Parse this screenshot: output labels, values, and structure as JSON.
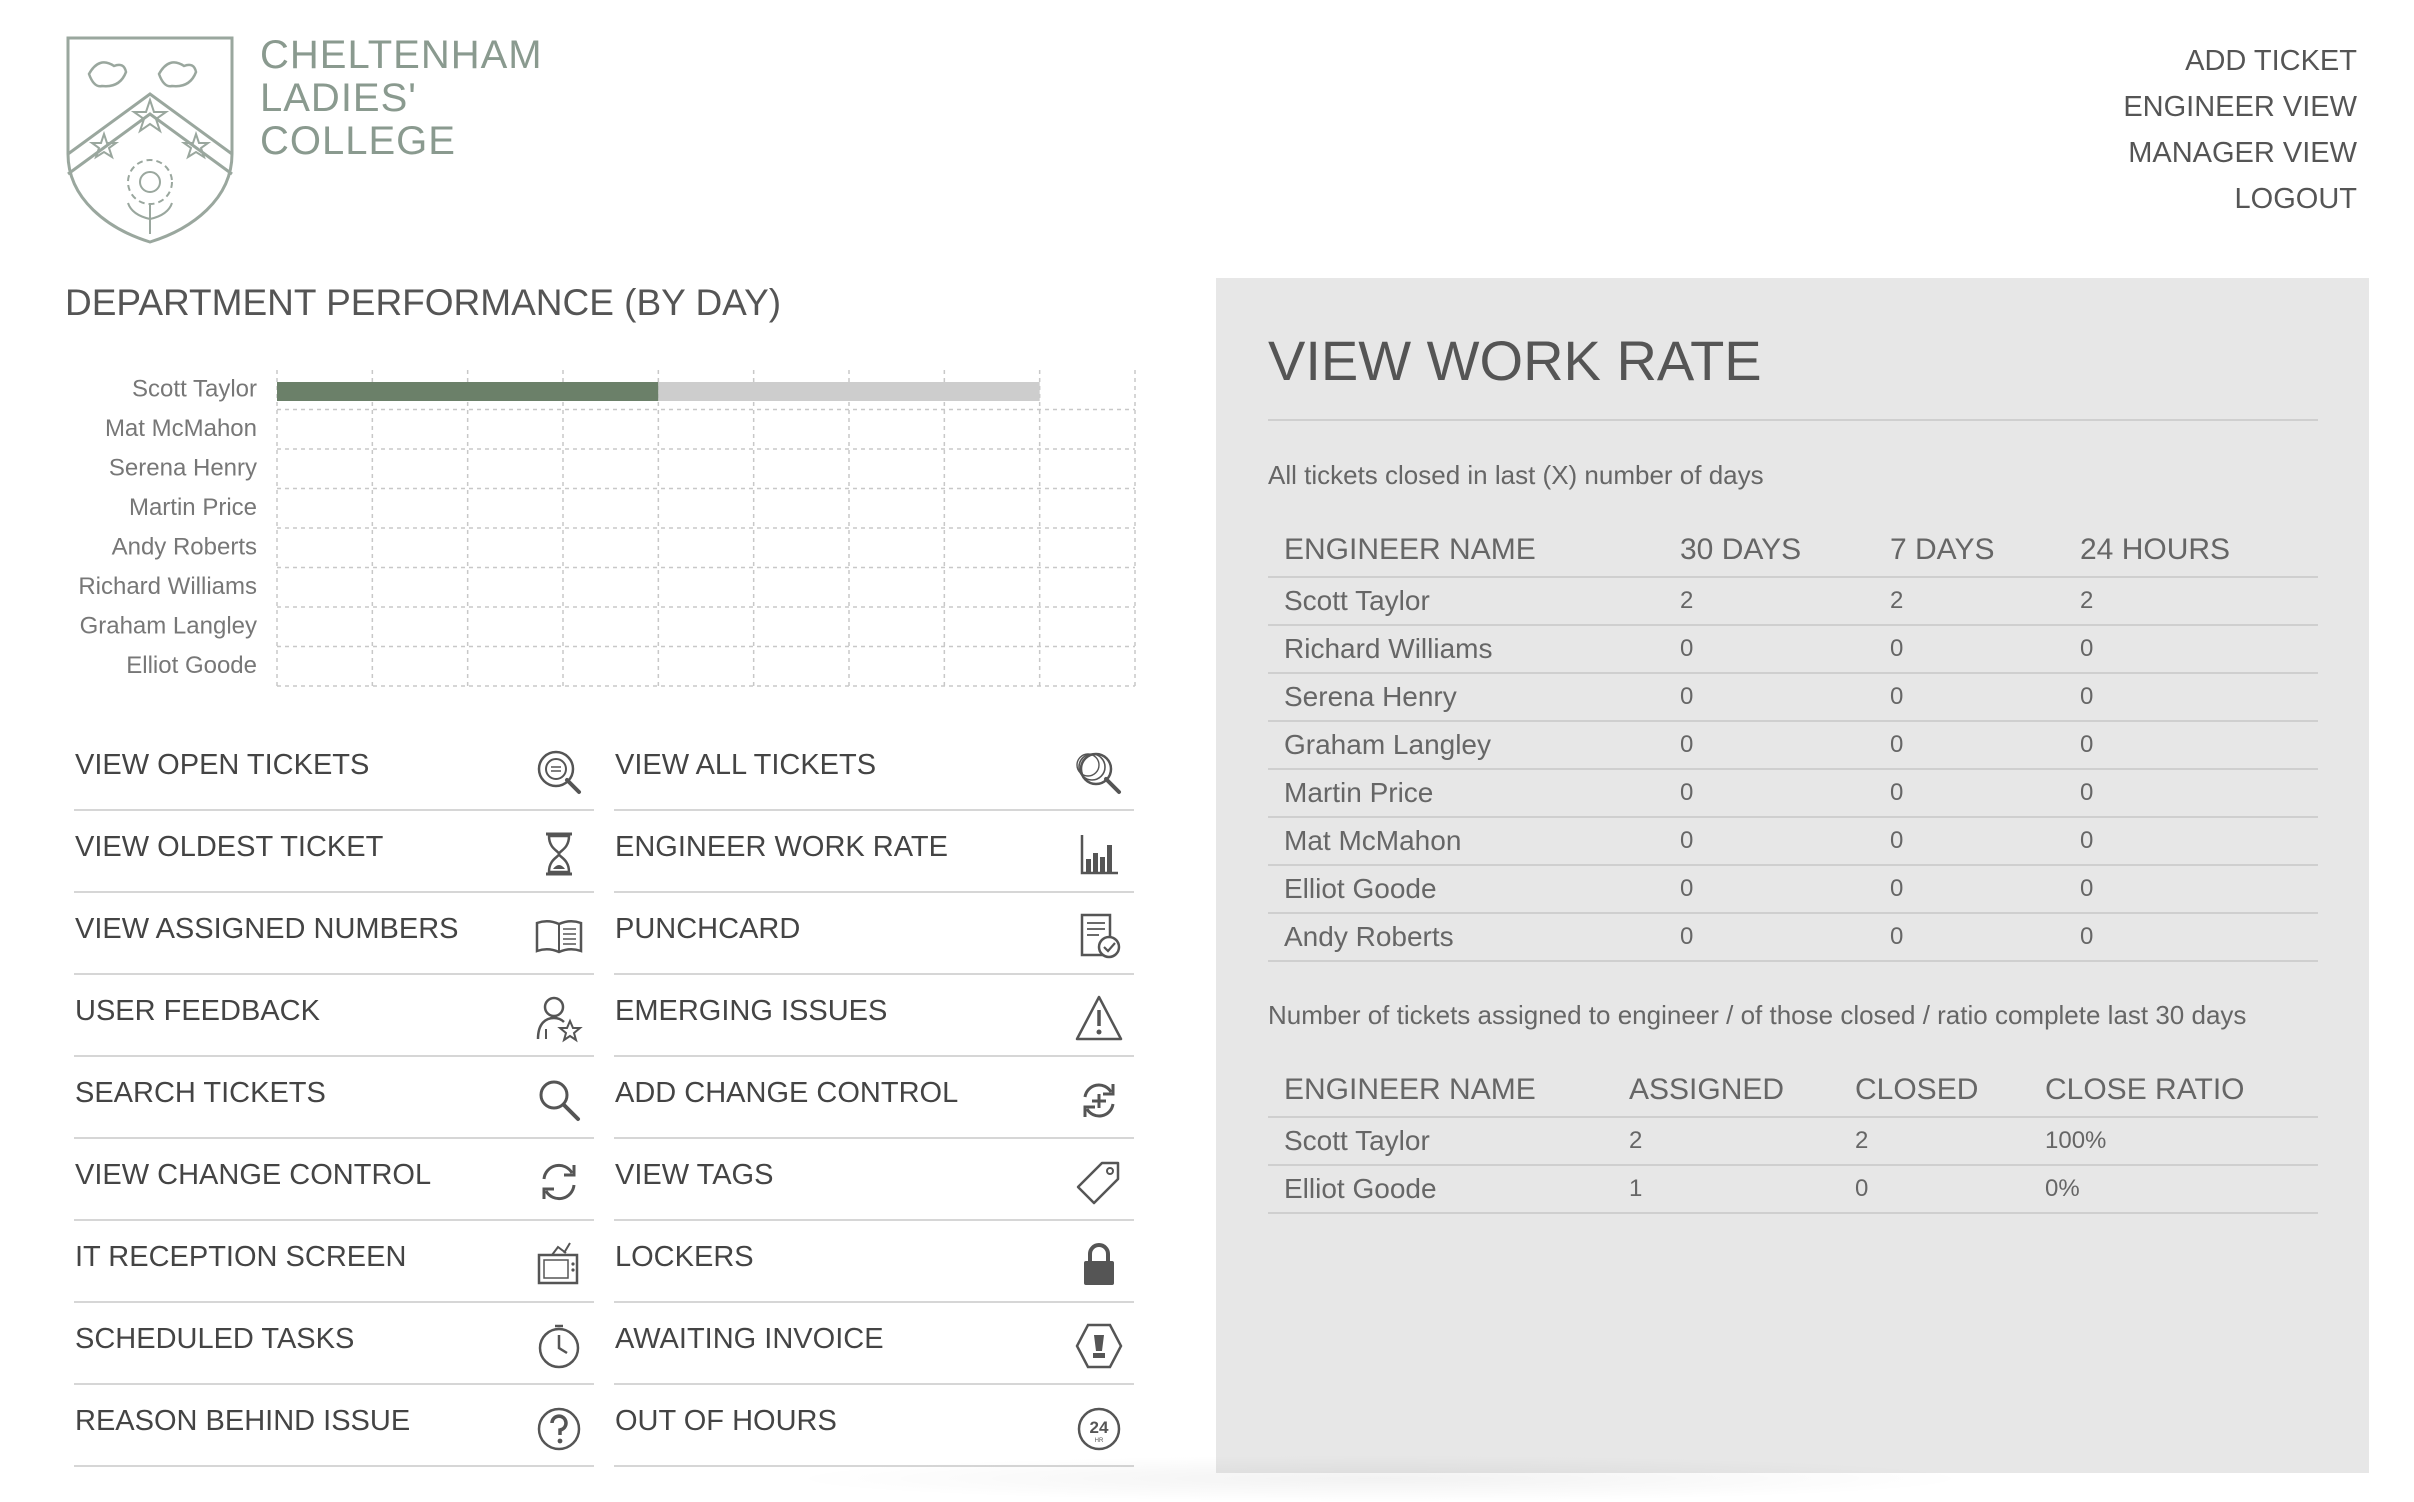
{
  "college": {
    "line1": "Cheltenham",
    "line2": "Ladies'",
    "line3": "College"
  },
  "nav": [
    "ADD TICKET",
    "ENGINEER VIEW",
    "MANAGER VIEW",
    "LOGOUT"
  ],
  "chart_title": "Department Performance (by day)",
  "chart_data": {
    "type": "bar",
    "orientation": "horizontal",
    "categories": [
      "Scott Taylor",
      "Mat McMahon",
      "Serena Henry",
      "Martin Price",
      "Andy Roberts",
      "Richard Williams",
      "Graham Langley",
      "Elliot Goode"
    ],
    "series": [
      {
        "values": [
          1,
          0,
          0,
          0,
          0,
          0,
          0,
          0
        ],
        "color": "#6b8069"
      },
      {
        "values": [
          1,
          0,
          0,
          0,
          0,
          0,
          0,
          0
        ],
        "color": "#cdcdcd"
      }
    ],
    "stacked": true,
    "xlim": [
      0,
      2.25
    ],
    "xticks": [
      0,
      0.25,
      0.5,
      0.75,
      1,
      1.25,
      1.5,
      1.75,
      2
    ],
    "xtick_labels": [
      "0",
      "0.25",
      "0.5",
      "0.75",
      "1",
      "1.25",
      "1.5",
      "1.75",
      "2"
    ],
    "grid": true
  },
  "menu": {
    "left": [
      {
        "label": "VIEW OPEN TICKETS",
        "icon": "search-tickets-icon"
      },
      {
        "label": "VIEW OLDEST TICKET",
        "icon": "hourglass-icon"
      },
      {
        "label": "VIEW ASSIGNED NUMBERS",
        "icon": "book-icon"
      },
      {
        "label": "USER FEEDBACK",
        "icon": "user-star-icon"
      },
      {
        "label": "SEARCH TICKETS",
        "icon": "search-icon"
      },
      {
        "label": "VIEW CHANGE CONTROL",
        "icon": "refresh-icon"
      },
      {
        "label": "IT RECEPTION SCREEN",
        "icon": "tv-icon"
      },
      {
        "label": "SCHEDULED TASKS",
        "icon": "clock-icon"
      },
      {
        "label": "REASON BEHIND ISSUE",
        "icon": "question-icon"
      }
    ],
    "right": [
      {
        "label": "VIEW ALL TICKETS",
        "icon": "multi-search-icon"
      },
      {
        "label": "ENGINEER WORK RATE",
        "icon": "bar-chart-icon"
      },
      {
        "label": "PUNCHCARD",
        "icon": "punchcard-icon"
      },
      {
        "label": "EMERGING ISSUES",
        "icon": "warning-icon"
      },
      {
        "label": "ADD CHANGE CONTROL",
        "icon": "add-refresh-icon"
      },
      {
        "label": "VIEW TAGS",
        "icon": "tag-icon"
      },
      {
        "label": "LOCKERS",
        "icon": "lock-icon"
      },
      {
        "label": "AWAITING INVOICE",
        "icon": "invoice-icon"
      },
      {
        "label": "OUT OF HOURS",
        "icon": "24hr-icon"
      }
    ]
  },
  "work_rate": {
    "title": "View Work Rate",
    "subtitle1": "All tickets closed in last (X) number of days",
    "table1": {
      "headers": [
        "ENGINEER NAME",
        "30 DAYS",
        "7 DAYS",
        "24 HOURS"
      ],
      "rows": [
        [
          "Scott Taylor",
          "2",
          "2",
          "2"
        ],
        [
          "Richard Williams",
          "0",
          "0",
          "0"
        ],
        [
          "Serena Henry",
          "0",
          "0",
          "0"
        ],
        [
          "Graham Langley",
          "0",
          "0",
          "0"
        ],
        [
          "Martin Price",
          "0",
          "0",
          "0"
        ],
        [
          "Mat McMahon",
          "0",
          "0",
          "0"
        ],
        [
          "Elliot Goode",
          "0",
          "0",
          "0"
        ],
        [
          "Andy Roberts",
          "0",
          "0",
          "0"
        ]
      ]
    },
    "subtitle2": "Number of tickets assigned to engineer / of those closed / ratio complete last 30 days",
    "table2": {
      "headers": [
        "ENGINEER NAME",
        "ASSIGNED",
        "CLOSED",
        "CLOSE RATIO"
      ],
      "rows": [
        [
          "Scott Taylor",
          "2",
          "2",
          "100%"
        ],
        [
          "Elliot Goode",
          "1",
          "0",
          "0%"
        ]
      ]
    }
  },
  "colors": {
    "accent": "#6b8069",
    "bar_secondary": "#cdcdcd",
    "panel": "#e7e7e7",
    "logo": "#8a9a8f"
  }
}
